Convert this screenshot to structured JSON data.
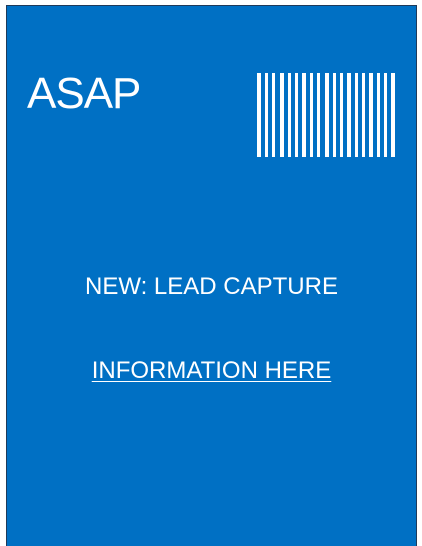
{
  "card": {
    "brand": "ASAP",
    "headline": "NEW: LEAD CAPTURE",
    "link_text": "INFORMATION HERE",
    "background_color": "#0070c4",
    "text_color": "#ffffff"
  },
  "barcode": {
    "icon": "barcode-icon"
  }
}
